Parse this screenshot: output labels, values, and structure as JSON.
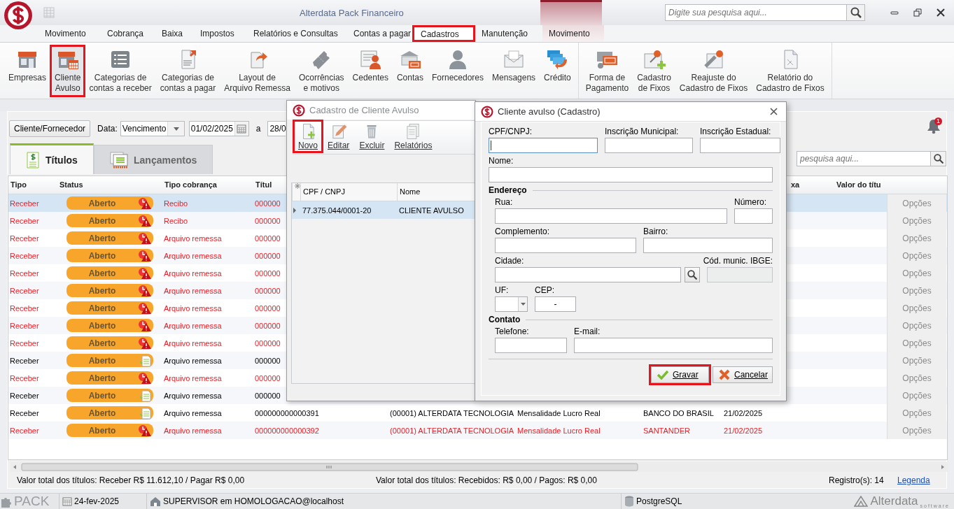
{
  "app": {
    "title": "Alterdata Pack Financeiro",
    "search_placeholder": "Digite sua pesquisa aqui..."
  },
  "menu": [
    {
      "label": "Movimento",
      "selected": false,
      "highlighted": false,
      "kind": "normal"
    },
    {
      "label": "Cobrança",
      "selected": false,
      "highlighted": false,
      "kind": "normal"
    },
    {
      "label": "Baixa",
      "selected": false,
      "highlighted": false,
      "kind": "normal"
    },
    {
      "label": "Impostos",
      "selected": false,
      "highlighted": false,
      "kind": "normal"
    },
    {
      "label": "Relatórios e Consultas",
      "selected": false,
      "highlighted": false,
      "kind": "normal"
    },
    {
      "label": "Contas a pagar",
      "selected": false,
      "highlighted": false,
      "kind": "normal"
    },
    {
      "label": "Cadastros",
      "selected": true,
      "highlighted": true,
      "kind": "normal"
    },
    {
      "label": "Manutenção",
      "selected": false,
      "highlighted": false,
      "kind": "normal"
    },
    {
      "label": "Movimento",
      "selected": false,
      "highlighted": false,
      "kind": "contextual"
    }
  ],
  "ribbon": {
    "groups": [
      {
        "items": [
          {
            "label": "Empresas",
            "highlighted": false
          },
          {
            "label": "Cliente\nAvulso",
            "highlighted": true
          },
          {
            "label": "Categorias de\ncontas a receber",
            "highlighted": false
          },
          {
            "label": "Categorias de\ncontas a pagar",
            "highlighted": false
          },
          {
            "label": "Layout de\nArquivo Remessa",
            "highlighted": false
          },
          {
            "label": "Ocorrências\ne motivos",
            "highlighted": false
          },
          {
            "label": "Cedentes",
            "highlighted": false
          },
          {
            "label": "Contas",
            "highlighted": false
          },
          {
            "label": "Fornecedores",
            "highlighted": false
          },
          {
            "label": "Mensagens",
            "highlighted": false
          },
          {
            "label": "Crédito",
            "highlighted": false
          }
        ]
      },
      {
        "items": [
          {
            "label": "Forma de\nPagamento",
            "highlighted": false
          },
          {
            "label": "Cadastro\nde Fixos",
            "highlighted": false
          },
          {
            "label": "Reajuste do\nCadastro de Fixos",
            "highlighted": false
          },
          {
            "label": "Relatório do\nCadastro de Fixos",
            "highlighted": false
          }
        ]
      }
    ]
  },
  "filter": {
    "client_button": "Cliente/Fornecedor",
    "date_label": "Data:",
    "date_type": "Vencimento",
    "date_from": "01/02/2025",
    "range_separator": "a",
    "date_to": "28/0"
  },
  "notifications": {
    "count": "1"
  },
  "tabs": [
    {
      "label": "Títulos",
      "selected": true
    },
    {
      "label": "Lançamentos",
      "selected": false
    }
  ],
  "table_search": {
    "placeholder": "pesquisa aqui..."
  },
  "table": {
    "columns": [
      "Tipo",
      "Status",
      "Tipo cobrança",
      "Títul",
      "xa",
      "Valor do títu"
    ],
    "rows": [
      {
        "tipo": "Receber",
        "status": "Aberto",
        "cobranca": "Recibo",
        "titulo": "000000",
        "overdue": true,
        "selected": true,
        "options": "Opções"
      },
      {
        "tipo": "Receber",
        "status": "Aberto",
        "cobranca": "Recibo",
        "titulo": "000000",
        "overdue": true,
        "selected": false,
        "options": "Opções"
      },
      {
        "tipo": "Receber",
        "status": "Aberto",
        "cobranca": "Arquivo remessa",
        "titulo": "000000",
        "overdue": true,
        "selected": false,
        "options": "Opções"
      },
      {
        "tipo": "Receber",
        "status": "Aberto",
        "cobranca": "Arquivo remessa",
        "titulo": "000000",
        "overdue": true,
        "selected": false,
        "options": "Opções"
      },
      {
        "tipo": "Receber",
        "status": "Aberto",
        "cobranca": "Arquivo remessa",
        "titulo": "000000",
        "overdue": true,
        "selected": false,
        "options": "Opções"
      },
      {
        "tipo": "Receber",
        "status": "Aberto",
        "cobranca": "Arquivo remessa",
        "titulo": "000000",
        "overdue": true,
        "selected": false,
        "options": "Opções"
      },
      {
        "tipo": "Receber",
        "status": "Aberto",
        "cobranca": "Arquivo remessa",
        "titulo": "000000",
        "overdue": true,
        "selected": false,
        "options": "Opções"
      },
      {
        "tipo": "Receber",
        "status": "Aberto",
        "cobranca": "Arquivo remessa",
        "titulo": "000000",
        "overdue": true,
        "selected": false,
        "options": "Opções"
      },
      {
        "tipo": "Receber",
        "status": "Aberto",
        "cobranca": "Arquivo remessa",
        "titulo": "000000",
        "overdue": true,
        "selected": false,
        "options": "Opções"
      },
      {
        "tipo": "Receber",
        "status": "Aberto",
        "cobranca": "Arquivo remessa",
        "titulo": "000000",
        "overdue": false,
        "selected": false,
        "options": "Opções"
      },
      {
        "tipo": "Receber",
        "status": "Aberto",
        "cobranca": "Arquivo remessa",
        "titulo": "000000",
        "overdue": true,
        "selected": false,
        "options": "Opções"
      },
      {
        "tipo": "Receber",
        "status": "Aberto",
        "cobranca": "Arquivo remessa",
        "titulo": "000000",
        "overdue": false,
        "selected": false,
        "options": "Opções"
      },
      {
        "tipo": "Receber",
        "status": "Aberto",
        "cobranca": "Arquivo remessa",
        "titulo": "000000000000391",
        "extra": [
          "(00001) ALTERDATA TECNOLOGIA",
          "Mensalidade Lucro Real",
          "BANCO DO BRASIL",
          "21/02/2025"
        ],
        "overdue": false,
        "selected": false,
        "options": "Opções"
      },
      {
        "tipo": "Receber",
        "status": "Aberto",
        "cobranca": "Arquivo remessa",
        "titulo": "000000000000392",
        "extra": [
          "(00001) ALTERDATA TECNOLOGIA",
          "Mensalidade Lucro Real",
          "SANTANDER",
          "21/02/2025"
        ],
        "overdue": true,
        "selected": false,
        "options": "Opções"
      }
    ]
  },
  "footer": {
    "totals": "Valor total dos títulos: Receber R$ 11.612,10 / Pagar R$ 0,00",
    "received": "Valor total dos títulos: Recebidos: R$ 0,00 / Pagos: R$ 0,00",
    "records": "Registro(s): 14",
    "legend_link": "Legenda"
  },
  "status_bar": {
    "product": "PACK",
    "date": "24-fev-2025",
    "user": "SUPERVISOR em HOMOLOGACAO@localhost",
    "database": "PostgreSQL",
    "brand": "Alterdata",
    "brand_tagline": "software"
  },
  "list_dialog": {
    "title": "Cadastro de Cliente Avulso",
    "toolbar": [
      {
        "label": "Novo",
        "highlighted": true
      },
      {
        "label": "Editar",
        "highlighted": false
      },
      {
        "label": "Excluir",
        "highlighted": false
      },
      {
        "label": "Relatórios",
        "highlighted": false
      }
    ],
    "columns": [
      "CPF / CNPJ",
      "Nome"
    ],
    "rows": [
      {
        "cells": [
          "77.375.044/0001-20",
          "CLIENTE AVULSO"
        ],
        "selected": true
      }
    ]
  },
  "form_dialog": {
    "title": "Cliente avulso (Cadastro)",
    "fields": [
      {
        "label": "CPF/CNPJ:",
        "focused": true
      },
      {
        "label": "Inscrição Municipal:",
        "focused": false
      },
      {
        "label": "Inscrição Estadual:",
        "focused": false
      },
      {
        "label": "Nome:",
        "focused": false
      }
    ],
    "sections": [
      {
        "title": "Endereço",
        "fields": [
          {
            "label": "Rua:",
            "kind": "text",
            "disabled": false
          },
          {
            "label": "Número:",
            "kind": "text",
            "disabled": false
          },
          {
            "label": "Complemento:",
            "kind": "text",
            "disabled": false
          },
          {
            "label": "Bairro:",
            "kind": "text",
            "disabled": false
          },
          {
            "label": "Cidade:",
            "kind": "lookup",
            "disabled": false
          },
          {
            "label": "Cód. munic. IBGE:",
            "kind": "text",
            "disabled": true
          },
          {
            "label": "UF:",
            "kind": "select",
            "disabled": false
          },
          {
            "label": "CEP:",
            "kind": "text",
            "disabled": false,
            "value": "-"
          }
        ]
      },
      {
        "title": "Contato",
        "fields": [
          {
            "label": "Telefone:",
            "kind": "text",
            "disabled": false
          },
          {
            "label": "E-mail:",
            "kind": "text",
            "disabled": false
          }
        ]
      }
    ],
    "buttons": [
      {
        "label": "Gravar",
        "kind": "save",
        "highlighted": true
      },
      {
        "label": "Cancelar",
        "kind": "cancel",
        "highlighted": false
      }
    ]
  }
}
